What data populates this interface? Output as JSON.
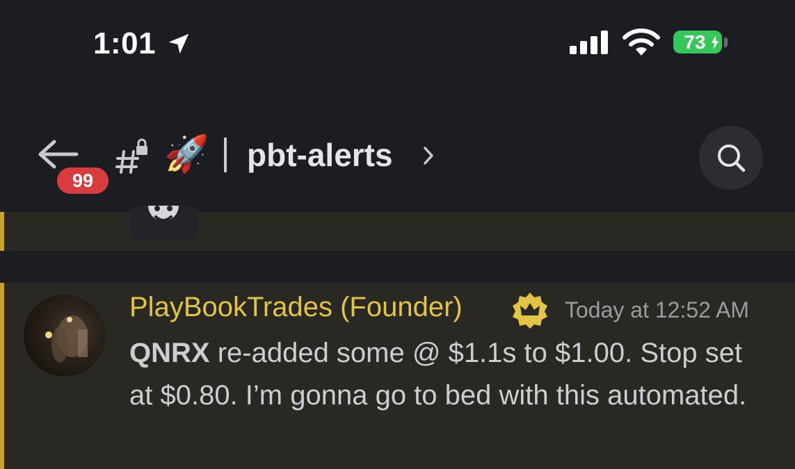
{
  "status_bar": {
    "time": "1:01",
    "battery": "73"
  },
  "header": {
    "unread_badge": "99",
    "channel_emoji": "🚀",
    "channel_name": "pbt-alerts"
  },
  "message": {
    "author": "PlayBookTrades (Founder)",
    "timestamp": "Today at 12:52 AM",
    "ticker": "QNRX",
    "text": " re-added some @ $1.1s to $1.00. Stop set at $0.80. I’m gonna go to bed with this automated."
  },
  "colors": {
    "accent": "#c9a227",
    "author": "#e2c545",
    "badge": "#d83c3e",
    "battery": "#34c759"
  }
}
